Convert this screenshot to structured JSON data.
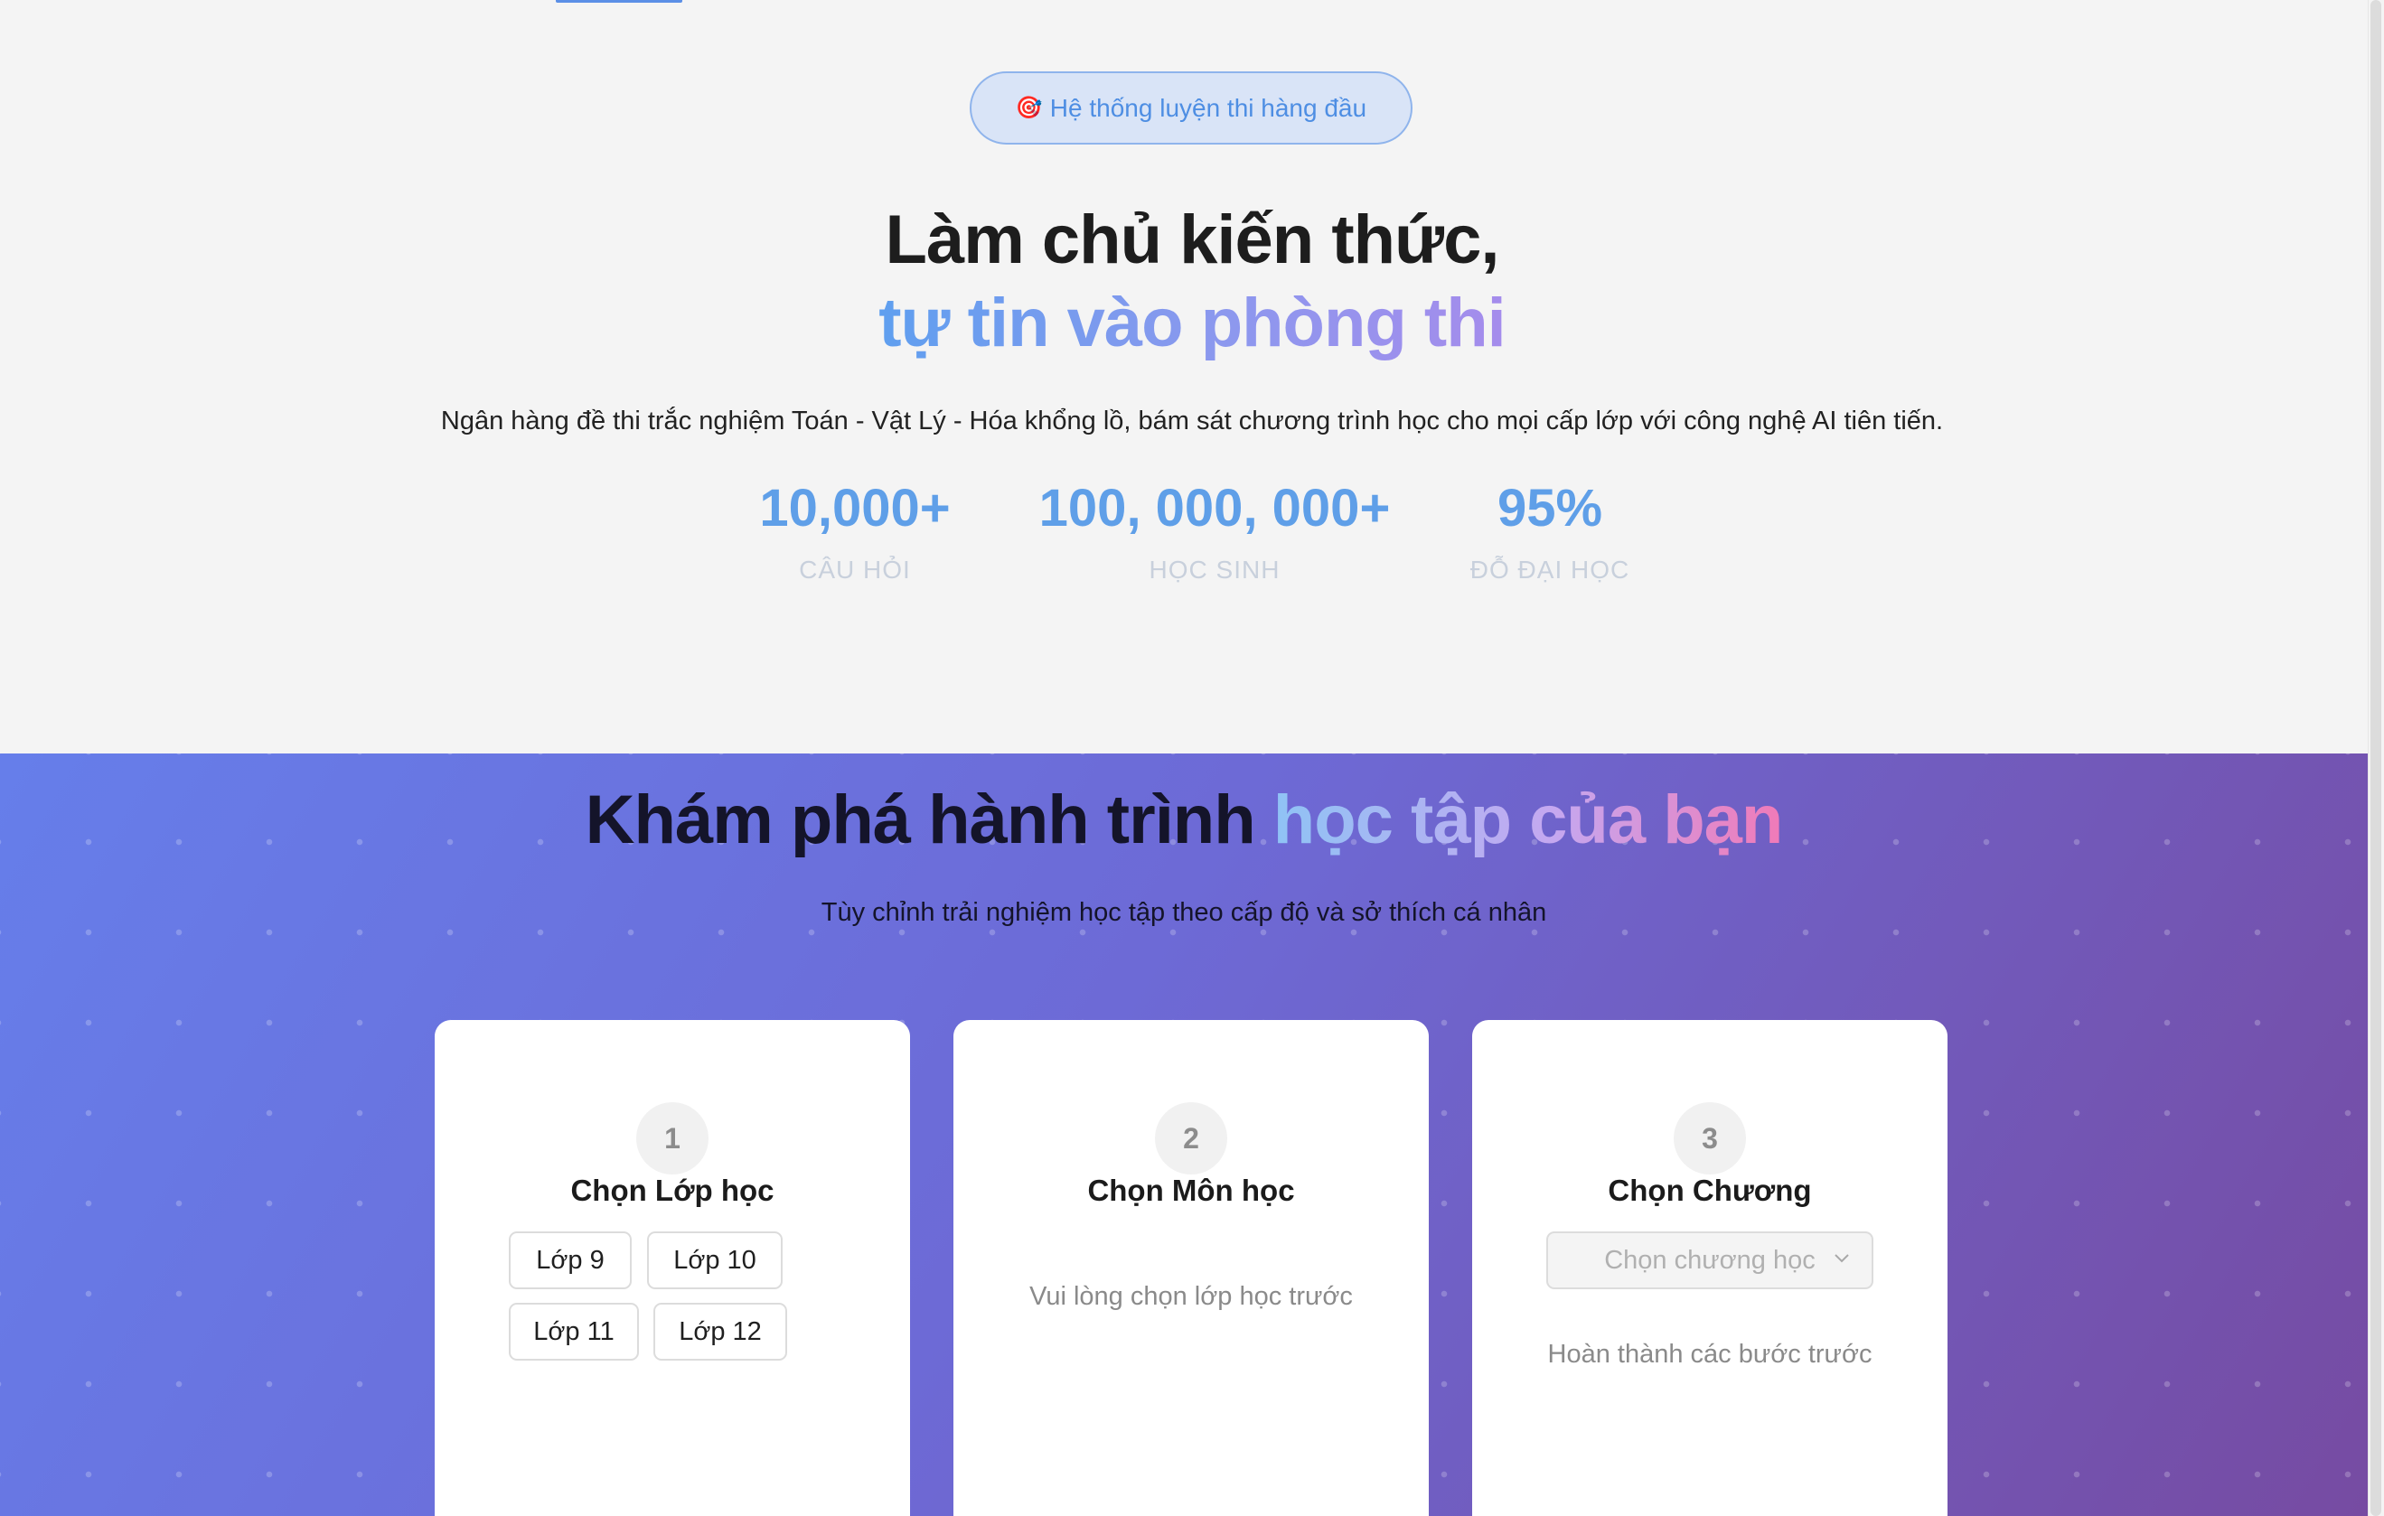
{
  "hero": {
    "badge_icon": "🎯",
    "badge_label": "Hệ thống luyện thi hàng đầu",
    "title_line1": "Làm chủ kiến thức,",
    "title_line2": "tự tin vào phòng thi",
    "description": "Ngân hàng đề thi trắc nghiệm Toán - Vật Lý - Hóa khổng lồ, bám sát chương trình học cho mọi cấp lớp với công nghệ AI tiên tiến.",
    "stats": [
      {
        "value": "10,000+",
        "label": "CÂU HỎI"
      },
      {
        "value": "100, 000, 000+",
        "label": "HỌC SINH"
      },
      {
        "value": "95%",
        "label": "ĐỖ ĐẠI HỌC"
      }
    ]
  },
  "journey": {
    "title_plain": "Khám phá hành trình ",
    "title_highlight": "học tập của bạn",
    "subtitle": "Tùy chỉnh trải nghiệm học tập theo cấp độ và sở thích cá nhân",
    "steps": [
      {
        "number": "1",
        "title": "Chọn Lớp học",
        "grades": [
          "Lớp 9",
          "Lớp 10",
          "Lớp 11",
          "Lớp 12"
        ]
      },
      {
        "number": "2",
        "title": "Chọn Môn học",
        "hint": "Vui lòng chọn lớp học trước"
      },
      {
        "number": "3",
        "title": "Chọn Chương",
        "select_placeholder": "Chọn chương học",
        "hint": "Hoàn thành các bước trước"
      }
    ]
  },
  "colors": {
    "accent_blue": "#5f9fe8",
    "gradient_start": "#667eea",
    "gradient_end": "#764ba2"
  }
}
